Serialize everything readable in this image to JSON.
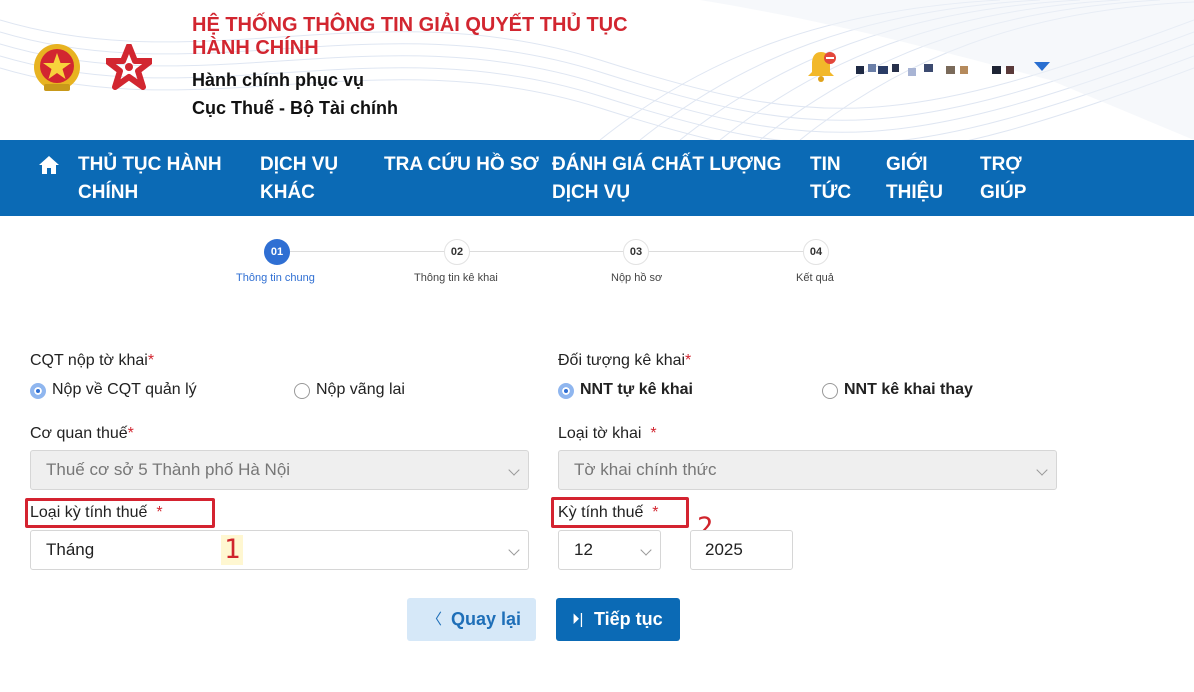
{
  "header": {
    "title": "HỆ THỐNG THÔNG TIN GIẢI QUYẾT THỦ TỤC HÀNH CHÍNH",
    "subtitle_1": "Hành chính phục vụ",
    "subtitle_2": "Cục Thuế - Bộ Tài chính"
  },
  "nav": {
    "items": [
      {
        "label": "THỦ TỤC HÀNH CHÍNH"
      },
      {
        "label": "DỊCH VỤ KHÁC"
      },
      {
        "label": "TRA CỨU HỒ SƠ"
      },
      {
        "label": "ĐÁNH GIÁ CHẤT LƯỢNG DỊCH VỤ"
      },
      {
        "label": "TIN TỨC"
      },
      {
        "label": "GIỚI THIỆU"
      },
      {
        "label": "TRỢ GIÚP"
      }
    ]
  },
  "steps": [
    {
      "number": "01",
      "label": "Thông tin chung",
      "active": true
    },
    {
      "number": "02",
      "label": "Thông tin kê khai",
      "active": false
    },
    {
      "number": "03",
      "label": "Nộp hồ sơ",
      "active": false
    },
    {
      "number": "04",
      "label": "Kết quả",
      "active": false
    }
  ],
  "form": {
    "cqt_nop_label": "CQT nộp tờ khai",
    "cqt_nop_options": [
      "Nộp về CQT quản lý",
      "Nộp vãng lai"
    ],
    "cqt_nop_selected": "Nộp về CQT quản lý",
    "doi_tuong_label": "Đối tượng kê khai",
    "doi_tuong_options": [
      "NNT tự kê khai",
      "NNT kê khai thay"
    ],
    "doi_tuong_selected": "NNT tự kê khai",
    "co_quan_thue_label": "Cơ quan thuế",
    "co_quan_thue_value": "Thuế cơ sở 5 Thành phố Hà Nội",
    "loai_to_khai_label": "Loại tờ khai",
    "loai_to_khai_value": "Tờ khai chính thức",
    "loai_ky_label": "Loại kỳ tính thuế",
    "loai_ky_value": "Tháng",
    "ky_tinh_label": "Kỳ tính thuế",
    "ky_month_value": "12",
    "ky_year_value": "2025",
    "required_mark": "*"
  },
  "annotations": {
    "one": "1",
    "two": "2"
  },
  "buttons": {
    "back_label": "Quay lại",
    "next_label": "Tiếp tục"
  },
  "colors": {
    "primary": "#0b6ab5",
    "title_red": "#d22630",
    "highlight_red": "#d42330"
  },
  "icons": {
    "home": "home-icon",
    "bell": "bell-icon",
    "back": "chevron-left-icon",
    "next": "skip-forward-icon"
  }
}
